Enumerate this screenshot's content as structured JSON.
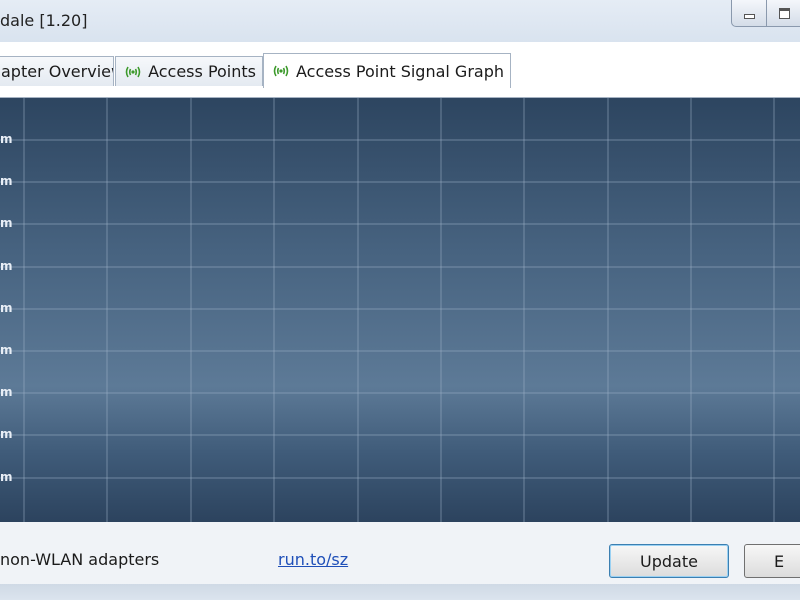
{
  "window": {
    "title": "dale [1.20]",
    "minimize_label": "",
    "maximize_label": ""
  },
  "tabs": [
    {
      "label": "apter Overview",
      "icon": null,
      "active": false
    },
    {
      "label": "Access Points",
      "icon": "wifi-antenna-icon",
      "active": false
    },
    {
      "label": "Access Point Signal Graph",
      "icon": "wifi-antenna-icon",
      "active": true
    }
  ],
  "graph": {
    "y_tick_labels": [
      "m",
      "m",
      "m",
      "m",
      "m",
      "m",
      "m",
      "m",
      "m"
    ],
    "colors": {
      "background_top": "#2d4560",
      "background_mid": "#5d7a97",
      "gridline": "#9fb3c8"
    }
  },
  "footer": {
    "option_text": "non-WLAN adapters",
    "link_text": "run.to/sz",
    "update_button": "Update",
    "exit_button": "E"
  }
}
